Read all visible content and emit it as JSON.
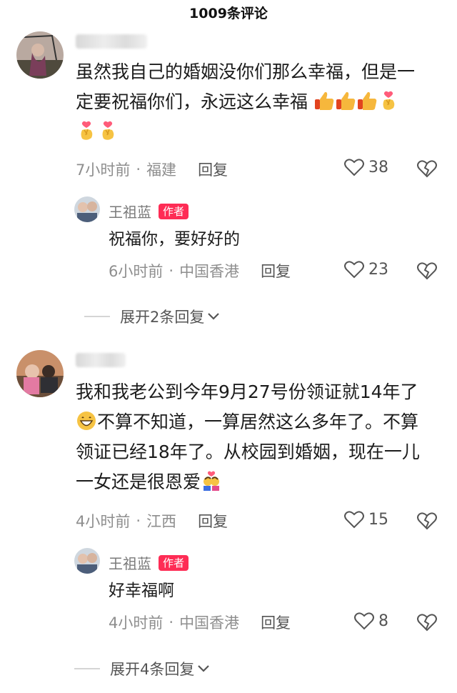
{
  "header": {
    "title": "1009条评论"
  },
  "comments": [
    {
      "text": "虽然我自己的婚姻没你们那么幸福，但是一定要祝福你们，永远这么幸福",
      "line1": "虽然我自己的婚姻没你们那么幸福，但是一",
      "line2": "定要祝福你们，永远这么幸福",
      "time": "7小时前",
      "sep": "·",
      "location": "福建",
      "reply_label": "回复",
      "likes": "38",
      "reply": {
        "user": "王祖蓝",
        "badge": "作者",
        "text": "祝福你，要好好的",
        "time": "6小时前",
        "sep": "·",
        "location": "中国香港",
        "reply_label": "回复",
        "likes": "23"
      },
      "expand": "展开2条回复"
    },
    {
      "text": "我和我老公到今年9月27号份领证就14年了不算不知道，一算居然这么多年了。不算领证已经18年了。从校园到婚姻，现在一儿一女还是很恩爱",
      "line1": "我和我老公到今年9月27号份领证就14年了",
      "line2": "不算不知道，一算居然这么多年了。不算",
      "line3": "领证已经18年了。从校园到婚姻，现在一儿",
      "line4": "一女还是很恩爱",
      "time": "4小时前",
      "sep": "·",
      "location": "江西",
      "reply_label": "回复",
      "likes": "15",
      "reply": {
        "user": "王祖蓝",
        "badge": "作者",
        "text": "好幸福啊",
        "time": "4小时前",
        "sep": "·",
        "location": "中国香港",
        "reply_label": "回复",
        "likes": "8"
      },
      "expand": "展开4条回复"
    }
  ],
  "icons": {
    "like": "heart-outline-icon",
    "dislike": "broken-heart-icon",
    "expand": "chevron-down-icon",
    "thumbs": "thumbs-up-emoji",
    "finger_heart": "finger-heart-emoji",
    "grin": "grinning-emoji",
    "kiss": "couple-kiss-emoji"
  },
  "colors": {
    "badge": "#fe2c55",
    "meta": "#8e8e8e",
    "text": "#1c1c1c"
  }
}
